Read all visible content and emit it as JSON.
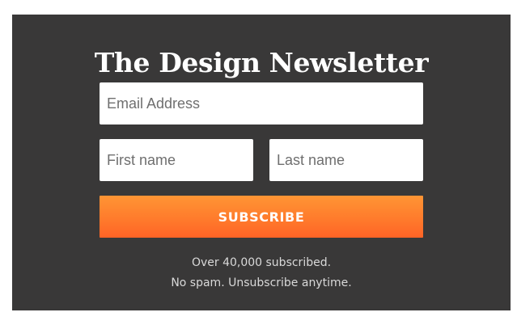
{
  "newsletter": {
    "title": "The Design Newsletter",
    "fields": {
      "email_placeholder": "Email Address",
      "first_name_placeholder": "First name",
      "last_name_placeholder": "Last name"
    },
    "subscribe_label": "SUBSCRIBE",
    "subscriber_note": "Over 40,000 subscribed.",
    "spam_note": "No spam. Unsubscribe anytime."
  },
  "colors": {
    "panel_background": "#393838",
    "button_gradient_top": "#ff9534",
    "button_gradient_bottom": "#ff6326",
    "text_light": "#ffffff"
  }
}
